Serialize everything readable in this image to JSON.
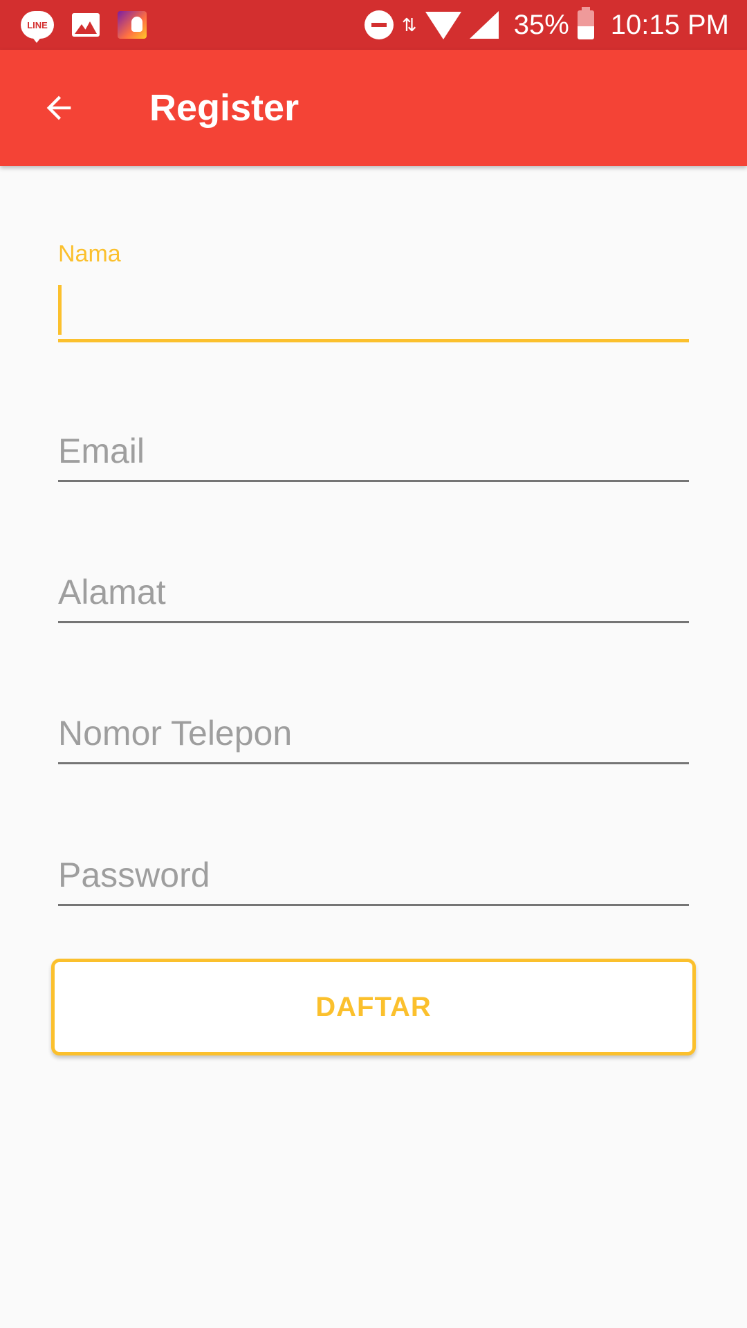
{
  "status_bar": {
    "line_icon_text": "LINE",
    "battery": "35%",
    "time": "10:15 PM",
    "data_arrows": "⇅",
    "icons": [
      "line-app-icon",
      "gallery-icon",
      "contacts-icon",
      "do-not-disturb-icon",
      "data-arrows-icon",
      "wifi-icon",
      "cell-signal-icon",
      "battery-icon"
    ]
  },
  "app_bar": {
    "title": "Register",
    "back_icon": "arrow-back-icon",
    "color": "#f44336"
  },
  "form": {
    "nama": {
      "label": "Nama",
      "value": ""
    },
    "email": {
      "placeholder": "Email",
      "value": ""
    },
    "alamat": {
      "placeholder": "Alamat",
      "value": ""
    },
    "telepon": {
      "placeholder": "Nomor Telepon",
      "value": ""
    },
    "password": {
      "placeholder": "Password",
      "value": ""
    }
  },
  "submit": {
    "label": "DAFTAR"
  },
  "colors": {
    "status_bar": "#d32f2f",
    "accent": "#fbc02d",
    "hint": "#9e9e9e",
    "underline": "#757575",
    "background": "#fafafa"
  }
}
